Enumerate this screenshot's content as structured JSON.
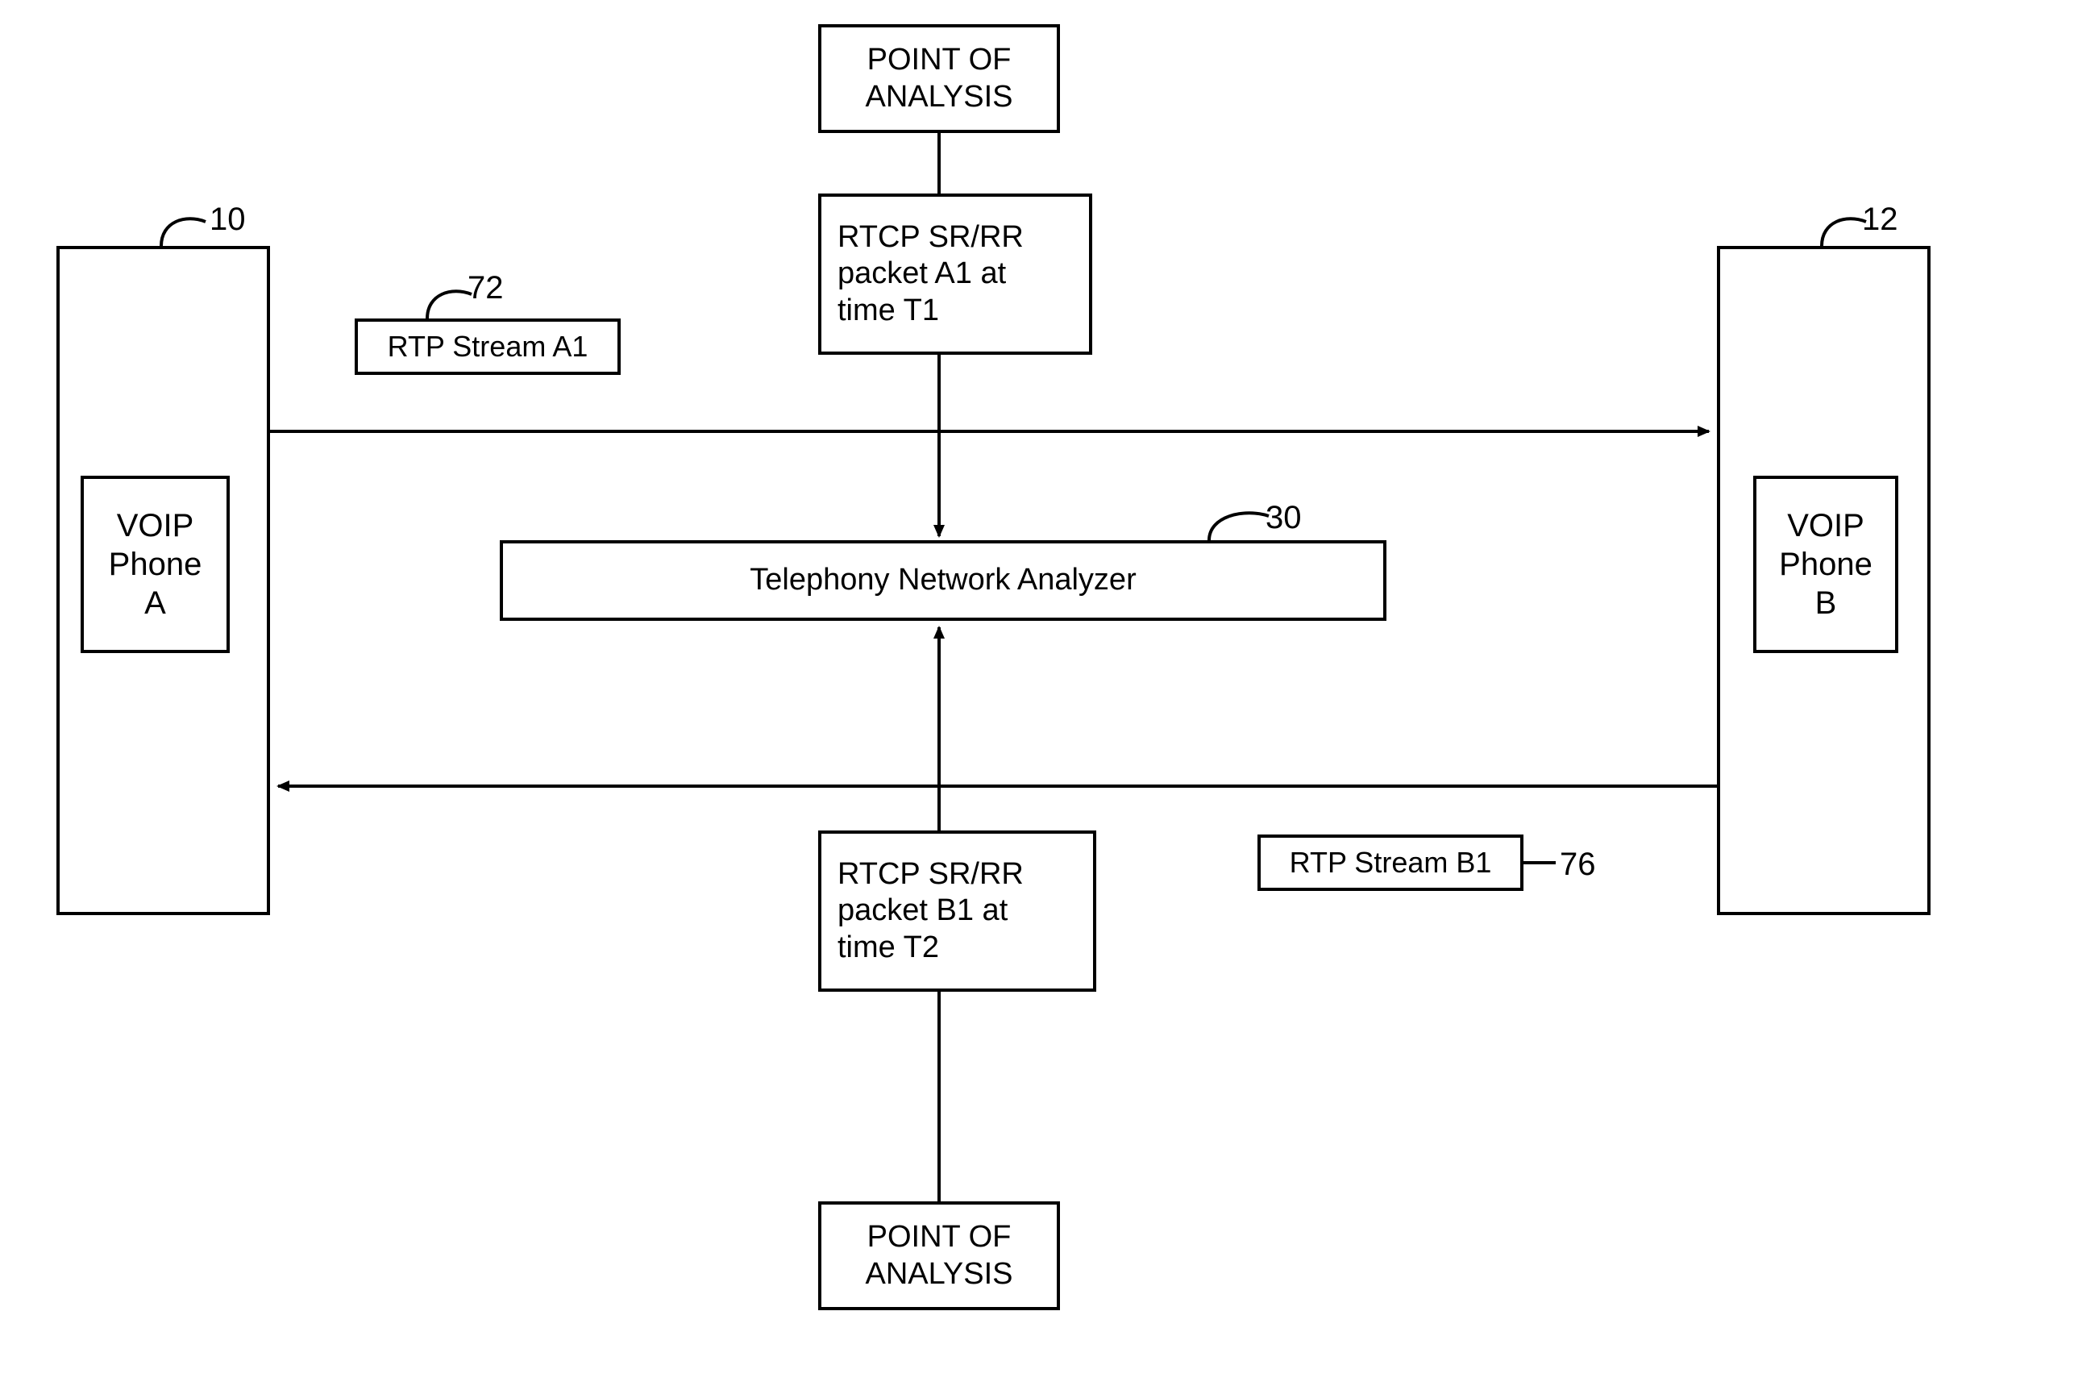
{
  "phone_a": {
    "label": "VOIP\nPhone\nA",
    "ref": "10"
  },
  "phone_b": {
    "label": "VOIP\nPhone\nB",
    "ref": "12"
  },
  "stream_a": {
    "label": "RTP Stream A1",
    "ref": "72"
  },
  "stream_b": {
    "label": "RTP Stream B1",
    "ref": "76"
  },
  "packet_a": {
    "label": "RTCP SR/RR\npacket A1 at\ntime T1"
  },
  "packet_b": {
    "label": "RTCP SR/RR\npacket B1 at\ntime T2"
  },
  "poa_top": {
    "label": "POINT OF\nANALYSIS"
  },
  "poa_bottom": {
    "label": "POINT OF\nANALYSIS"
  },
  "analyzer": {
    "label": "Telephony Network Analyzer",
    "ref": "30"
  }
}
